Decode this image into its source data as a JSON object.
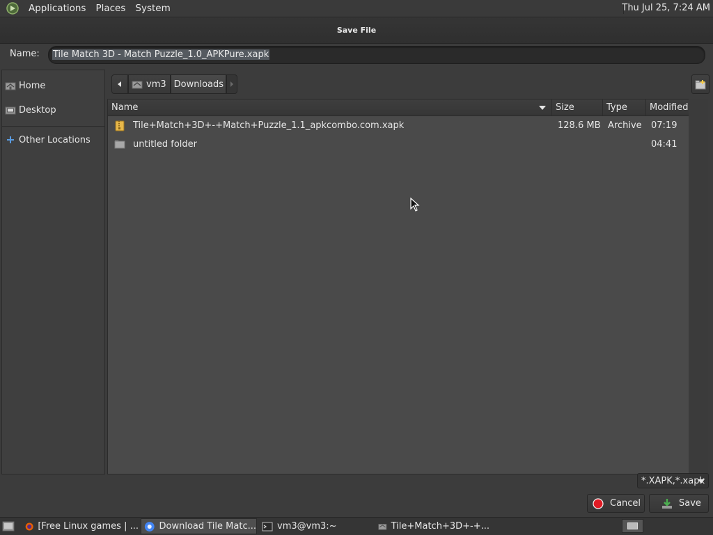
{
  "top_panel": {
    "menus": [
      "Applications",
      "Places",
      "System"
    ],
    "clock": "Thu Jul 25,  7:24 AM"
  },
  "dialog": {
    "title": "Save File",
    "name_label": "Name:",
    "name_value": "Tile Match 3D - Match Puzzle_1.0_APKPure.xapk"
  },
  "sidebar": {
    "items": [
      {
        "label": "Home",
        "icon": "home-icon"
      },
      {
        "label": "Desktop",
        "icon": "desktop-icon"
      },
      {
        "label": "Other Locations",
        "icon": "plus-icon"
      }
    ]
  },
  "path_bar": {
    "segments": [
      "vm3",
      "Downloads"
    ],
    "active": "Downloads"
  },
  "file_list": {
    "columns": [
      "Name",
      "Size",
      "Type",
      "Modified"
    ],
    "sort_column": "Name",
    "rows": [
      {
        "name": "Tile+Match+3D+-+Match+Puzzle_1.1_apkcombo.com.xapk",
        "size": "128.6 MB",
        "type": "Archive",
        "modified": "07:19",
        "icon": "archive-icon"
      },
      {
        "name": "untitled folder",
        "size": "",
        "type": "",
        "modified": "04:41",
        "icon": "folder-icon"
      }
    ]
  },
  "filter": {
    "selected": "*.XAPK,*.xapk"
  },
  "buttons": {
    "cancel": "Cancel",
    "save": "Save"
  },
  "taskbar": {
    "tasks": [
      {
        "label": "[Free Linux games | ...",
        "icon": "firefox-icon"
      },
      {
        "label": "Download Tile Matc...",
        "icon": "chrome-icon",
        "active": true
      },
      {
        "label": "vm3@vm3:~",
        "icon": "terminal-icon"
      },
      {
        "label": "Tile+Match+3D+-+...",
        "icon": "file-dialog-icon"
      }
    ]
  },
  "colors": {
    "panel_bg": "#3a3a3a",
    "dialog_bg": "#3c3c3c",
    "list_bg": "#4a4a4a",
    "selection": "#555a60",
    "cancel_red": "#e01b24",
    "save_green": "#4caf50",
    "archive_yellow": "#e8b84a"
  }
}
